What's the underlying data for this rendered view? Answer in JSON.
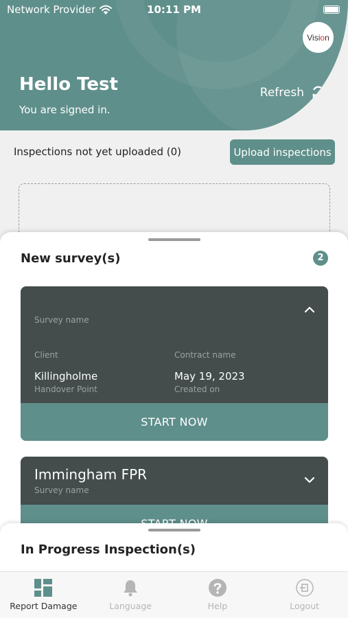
{
  "status_bar": {
    "carrier": "Network Provider",
    "time": "10:11 PM",
    "wifi_icon": "wifi-icon",
    "battery_icon": "battery-icon"
  },
  "header": {
    "logo_text_start": "Visi",
    "logo_text_accent": "o",
    "logo_text_end": "n",
    "greeting": "Hello Test",
    "subtitle": "You are signed in.",
    "refresh_label": "Refresh",
    "refresh_icon": "refresh-icon"
  },
  "uploads": {
    "pending_label": "Inspections not yet uploaded (0)",
    "upload_button": "Upload inspections"
  },
  "new_surveys": {
    "title": "New survey(s)",
    "count": "2",
    "cards": [
      {
        "survey_name_value": "",
        "survey_name_label": "Survey name",
        "client_label": "Client",
        "client_value": "Killingholme",
        "contract_label": "Contract name",
        "contract_value": "May 19, 2023",
        "handover_label": "Handover Point",
        "created_label": "Created on",
        "start_button": "START NOW",
        "chevron_icon": "chevron-up-icon"
      },
      {
        "survey_name_value": "Immingham FPR",
        "survey_name_label": "Survey name",
        "start_button": "START NOW",
        "chevron_icon": "chevron-down-icon"
      }
    ]
  },
  "in_progress": {
    "title": "In Progress Inspection(s)"
  },
  "bottom_nav": {
    "items": [
      {
        "label": "Report Damage",
        "icon": "grid-icon",
        "active": true
      },
      {
        "label": "Language",
        "icon": "bell-icon",
        "active": false
      },
      {
        "label": "Help",
        "icon": "help-icon",
        "active": false
      },
      {
        "label": "Logout",
        "icon": "logout-icon",
        "active": false
      }
    ]
  },
  "colors": {
    "brand_teal": "#5f8f8b",
    "card_dark": "#444c4c",
    "background": "#f0f0f0"
  }
}
